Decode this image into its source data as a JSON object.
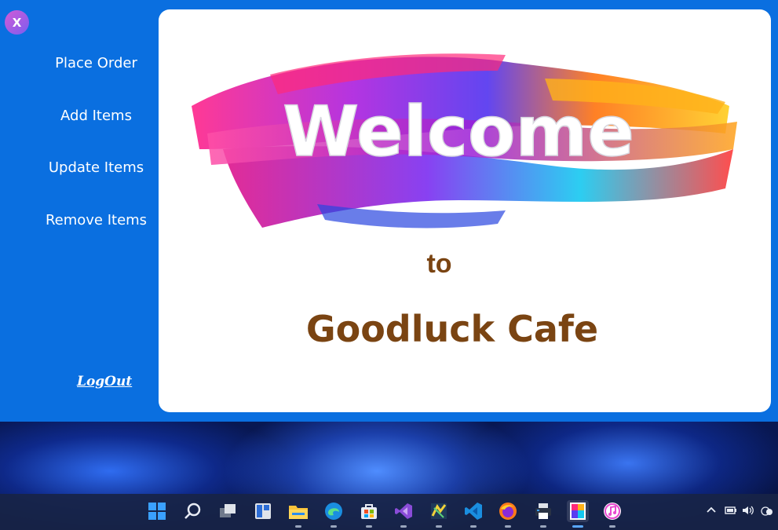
{
  "app": {
    "close_label": "X",
    "menu": [
      {
        "label": "Place Order"
      },
      {
        "label": "Add Items"
      },
      {
        "label": "Update Items"
      },
      {
        "label": "Remove Items"
      }
    ],
    "logout_label": "LogOut"
  },
  "content": {
    "welcome_text": "Welcome",
    "to_text": "to",
    "cafe_name": "Goodluck Cafe"
  },
  "colors": {
    "sidebar_blue": "#0a6fe0",
    "cafe_brown": "#7a4412"
  },
  "taskbar": {
    "icons": [
      "windows-start-icon",
      "search-icon",
      "task-view-icon",
      "widgets-icon",
      "file-explorer-icon",
      "edge-icon",
      "store-icon",
      "visual-studio-icon",
      "sketch-tool-icon",
      "vscode-icon",
      "firefox-icon",
      "printer-app-icon",
      "cafe-app-icon",
      "music-icon"
    ],
    "tray": [
      "chevron-up-icon",
      "battery-icon",
      "volume-icon",
      "network-icon"
    ]
  }
}
